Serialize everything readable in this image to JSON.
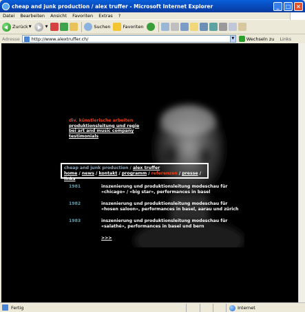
{
  "window": {
    "title": "cheap and junk production / alex truffer - Microsoft Internet Explorer",
    "controls": [
      "_",
      "□",
      "×"
    ]
  },
  "menubar": {
    "items": [
      "Datei",
      "Bearbeiten",
      "Ansicht",
      "Favoriten",
      "Extras",
      "?"
    ]
  },
  "toolbar": {
    "back_label": "Zurück",
    "search_label": "Suchen",
    "favorites_label": "Favoriten"
  },
  "addressbar": {
    "label": "Adresse",
    "url": "http://www.alextruffer.ch/",
    "go_label": "Wechseln zu",
    "links_label": "Links"
  },
  "page": {
    "side_menu": {
      "heading": "div. künstlerische arbeiten",
      "items": [
        "produktionsleitung und regie",
        "bei art and music company",
        "testimonials"
      ]
    },
    "nav": {
      "site_prefix": "cheap and junk production / ",
      "site_name": "alex truffer",
      "links": [
        "home",
        "news",
        "kontakt",
        "programm",
        "referenzen",
        "presse",
        "links"
      ],
      "separator": " / ",
      "active": "referenzen"
    },
    "entries": [
      {
        "year": "1981",
        "description": "inszenierung und produktionsleitung modeschau für «chicago» / «big star», performances in basel"
      },
      {
        "year": "1982",
        "description": "inszenierung und produktionsleitung modeschau für «hosen saloon», performances in basel, aarau und zürich"
      },
      {
        "year": "1983",
        "description": "inszenierung und produktionsleitung modeschau für «salathé», performances in basel und bern"
      }
    ],
    "more_link": ">>>"
  },
  "statusbar": {
    "text": "Fertig",
    "zone": "Internet"
  }
}
